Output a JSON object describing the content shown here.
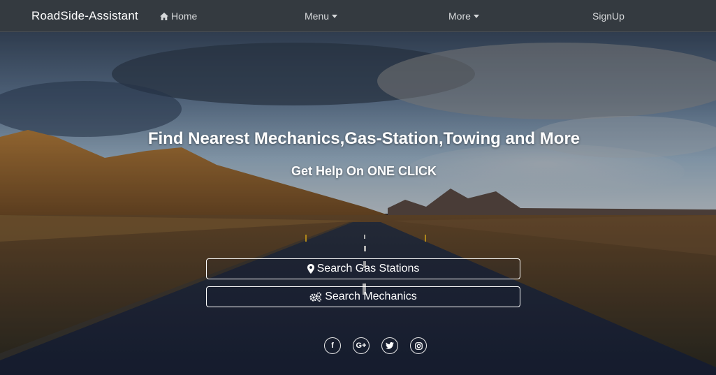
{
  "navbar": {
    "brand": "RoadSide-Assistant",
    "home_label": "Home",
    "home_icon": "home-icon",
    "menu_label": "Menu",
    "more_label": "More",
    "signup_label": "SignUp",
    "background": "#343a40"
  },
  "hero": {
    "headline": "Find Nearest Mechanics,Gas-Station,Towing and More",
    "subline": "Get Help On ONE CLICK",
    "buttons": {
      "gas_label": "Search Gas Stations",
      "gas_icon": "map-marker-icon",
      "mechanics_label": "Search Mechanics",
      "mechanics_icon": "cogs-icon"
    },
    "social": {
      "facebook": "f",
      "google_plus": "G+",
      "twitter_icon": "twitter-icon",
      "instagram_icon": "instagram-icon"
    }
  }
}
